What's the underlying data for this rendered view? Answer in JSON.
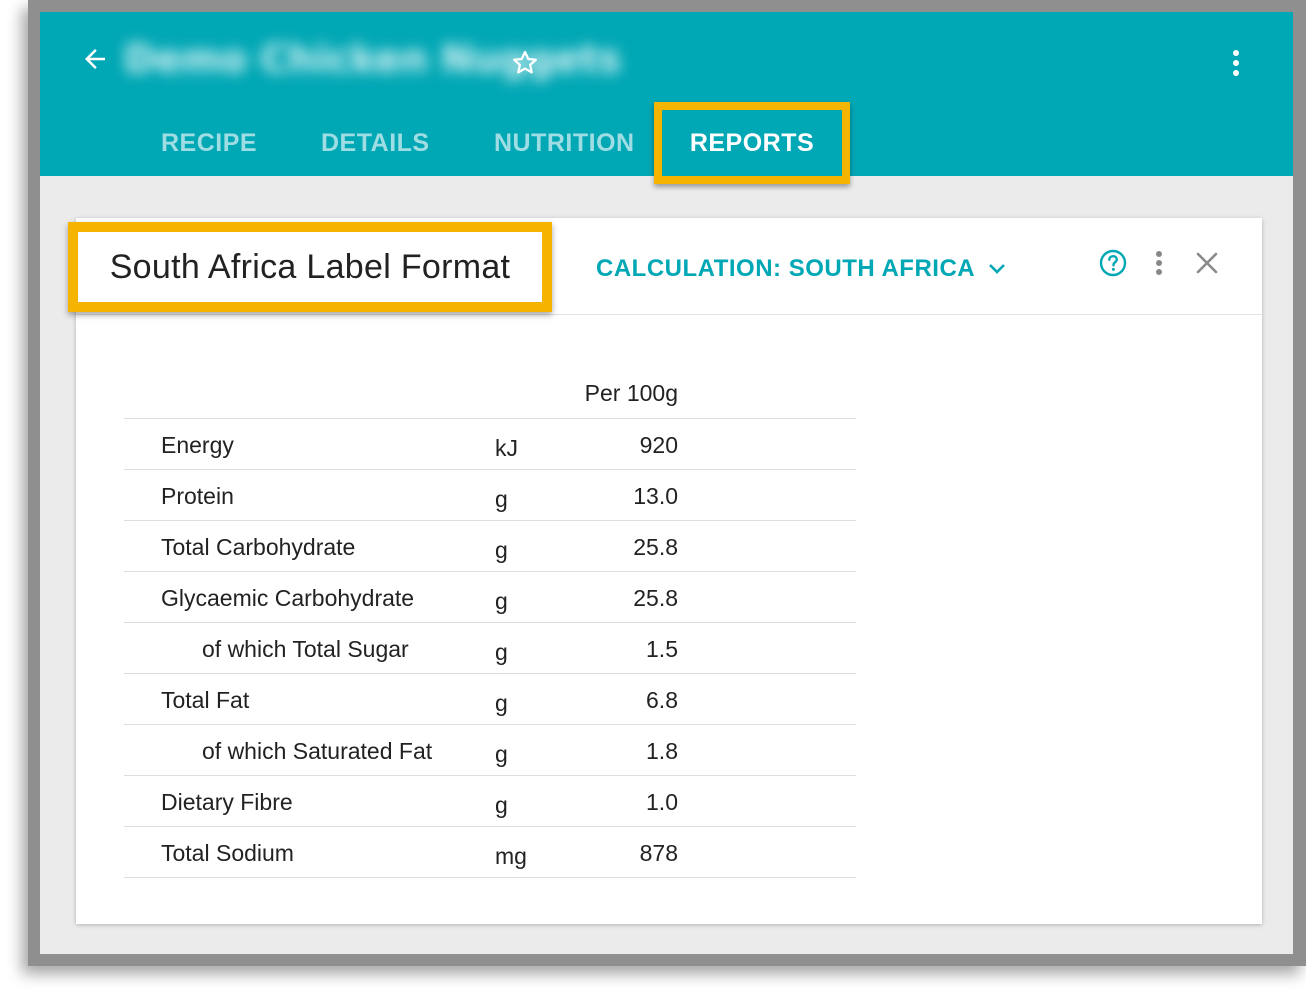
{
  "header": {
    "recipe_title": "Demo Chicken Nuggets",
    "tabs": [
      {
        "label": "RECIPE"
      },
      {
        "label": "DETAILS"
      },
      {
        "label": "NUTRITION"
      },
      {
        "label": "REPORTS",
        "active": true
      }
    ],
    "icons": {
      "back": "arrow-left-icon",
      "favorite": "star-outline-icon",
      "more": "more-vert-icon"
    }
  },
  "report": {
    "title": "South Africa Label Format",
    "calculation_label": "CALCULATION: SOUTH AFRICA",
    "icons": {
      "help": "help-circle-icon",
      "more": "more-vert-icon",
      "close": "close-icon",
      "dropdown": "chevron-down-icon"
    },
    "table": {
      "column_header": "Per 100g",
      "rows": [
        {
          "name": "Energy",
          "unit": "kJ",
          "value": "920"
        },
        {
          "name": "Protein",
          "unit": "g",
          "value": "13.0"
        },
        {
          "name": "Total Carbohydrate",
          "unit": "g",
          "value": "25.8"
        },
        {
          "name": "Glycaemic Carbohydrate",
          "unit": "g",
          "value": "25.8"
        },
        {
          "name": "of which Total Sugar",
          "unit": "g",
          "value": "1.5",
          "sub": true
        },
        {
          "name": "Total Fat",
          "unit": "g",
          "value": "6.8"
        },
        {
          "name": "of which Saturated Fat",
          "unit": "g",
          "value": "1.8",
          "sub": true
        },
        {
          "name": "Dietary Fibre",
          "unit": "g",
          "value": "1.0"
        },
        {
          "name": "Total Sodium",
          "unit": "mg",
          "value": "878"
        }
      ]
    }
  },
  "colors": {
    "primary": "#00a7b5",
    "highlight": "#f5b400",
    "background": "#ebebeb"
  }
}
